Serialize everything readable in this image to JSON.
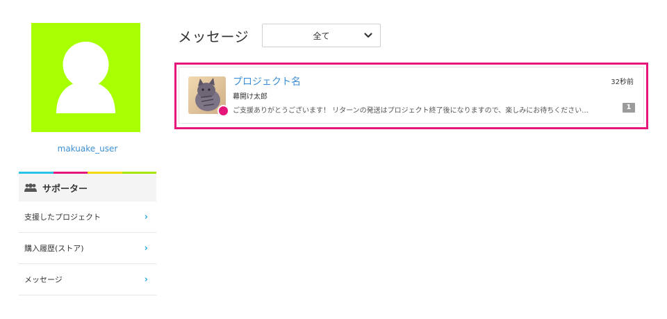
{
  "profile": {
    "username": "makuake_user",
    "avatar_color": "#a7ff00",
    "avatar_icon": "user-silhouette-icon"
  },
  "sidebar": {
    "color_bar": [
      "#29c3e8",
      "#e5157a",
      "#f5d800",
      "#a7e600"
    ],
    "section_title": "サポーター",
    "section_icon": "group-icon",
    "items": [
      {
        "label": "支援したプロジェクト",
        "icon": "chevron-right-icon"
      },
      {
        "label": "購入履歴(ストア)",
        "icon": "chevron-right-icon"
      },
      {
        "label": "メッセージ",
        "icon": "chevron-right-icon"
      }
    ]
  },
  "main": {
    "title": "メッセージ",
    "filter": {
      "selected": "全て",
      "icon": "chevron-down-icon"
    },
    "messages": [
      {
        "project_name": "プロジェクト名",
        "sender": "幕開け太郎",
        "snippet": "ご支援ありがとうございます！ リターンの発送はプロジェクト終了後になりますので、楽しみにお待ちください...",
        "time": "32秒前",
        "unread_count": "1",
        "unread_dot_color": "#e5157a",
        "thumbnail": "cat-photo-thumbnail"
      }
    ]
  },
  "colors": {
    "accent_pink": "#e5157a",
    "link_blue": "#3c8fd6",
    "chevron_blue": "#29a9e1"
  }
}
